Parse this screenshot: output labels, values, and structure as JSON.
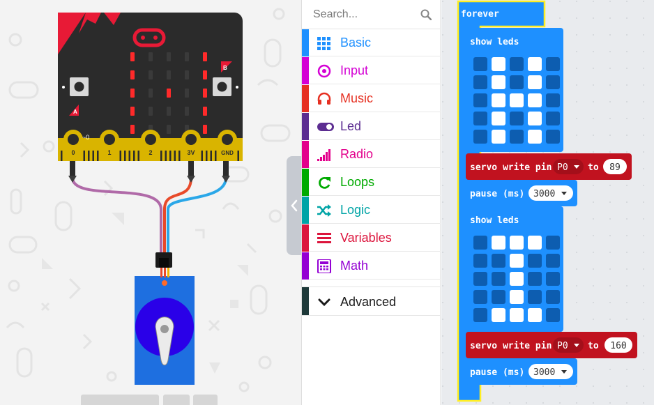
{
  "simulator": {
    "board": {
      "button_a_label": "A",
      "button_b_label": "B",
      "pins": [
        "0",
        "1",
        "2",
        "3V",
        "GND"
      ],
      "pin_note": "~0",
      "led_matrix": [
        [
          1,
          0,
          0,
          0,
          1
        ],
        [
          1,
          0,
          0,
          0,
          1
        ],
        [
          1,
          0,
          1,
          0,
          1
        ],
        [
          1,
          0,
          0,
          0,
          1
        ],
        [
          1,
          0,
          0,
          0,
          1
        ]
      ],
      "led_color": "#ff2a2a"
    },
    "servo_color": "#1e6fe0"
  },
  "toolbox": {
    "search_placeholder": "Search...",
    "categories": [
      {
        "label": "Basic",
        "color": "#1e90ff",
        "icon": "grid-icon"
      },
      {
        "label": "Input",
        "color": "#d400d4",
        "icon": "target-icon"
      },
      {
        "label": "Music",
        "color": "#e63022",
        "icon": "headphones-icon"
      },
      {
        "label": "Led",
        "color": "#5c2d91",
        "icon": "toggle-icon"
      },
      {
        "label": "Radio",
        "color": "#e3008c",
        "icon": "signal-bars-icon"
      },
      {
        "label": "Loops",
        "color": "#00aa00",
        "icon": "loop-arrow-icon"
      },
      {
        "label": "Logic",
        "color": "#00a4a6",
        "icon": "shuffle-icon"
      },
      {
        "label": "Variables",
        "color": "#dc143c",
        "icon": "lines-icon"
      },
      {
        "label": "Math",
        "color": "#9400d3",
        "icon": "calculator-icon"
      }
    ],
    "advanced_label": "Advanced"
  },
  "workspace": {
    "forever_label": "forever",
    "blocks": [
      {
        "type": "show_leds",
        "label": "show leds",
        "leds": [
          [
            0,
            1,
            0,
            1,
            0
          ],
          [
            0,
            1,
            0,
            1,
            0
          ],
          [
            0,
            1,
            1,
            1,
            0
          ],
          [
            0,
            1,
            0,
            1,
            0
          ],
          [
            0,
            1,
            0,
            1,
            0
          ]
        ]
      },
      {
        "type": "servo",
        "label": "servo write pin",
        "pin": "P0",
        "to_label": "to",
        "value": "89"
      },
      {
        "type": "pause",
        "label": "pause (ms)",
        "value": "3000"
      },
      {
        "type": "show_leds",
        "label": "show leds",
        "leds": [
          [
            0,
            1,
            1,
            1,
            0
          ],
          [
            0,
            0,
            1,
            0,
            0
          ],
          [
            0,
            0,
            1,
            0,
            0
          ],
          [
            0,
            0,
            1,
            0,
            0
          ],
          [
            0,
            1,
            1,
            1,
            0
          ]
        ]
      },
      {
        "type": "servo",
        "label": "servo write pin",
        "pin": "P0",
        "to_label": "to",
        "value": "160"
      },
      {
        "type": "pause",
        "label": "pause (ms)",
        "value": "3000"
      }
    ],
    "colors": {
      "loops": "#1e90ff",
      "basic": "#1e90ff",
      "servo": "#c1121f",
      "forever": "#1e90ff",
      "outline": "#ffee22"
    }
  }
}
